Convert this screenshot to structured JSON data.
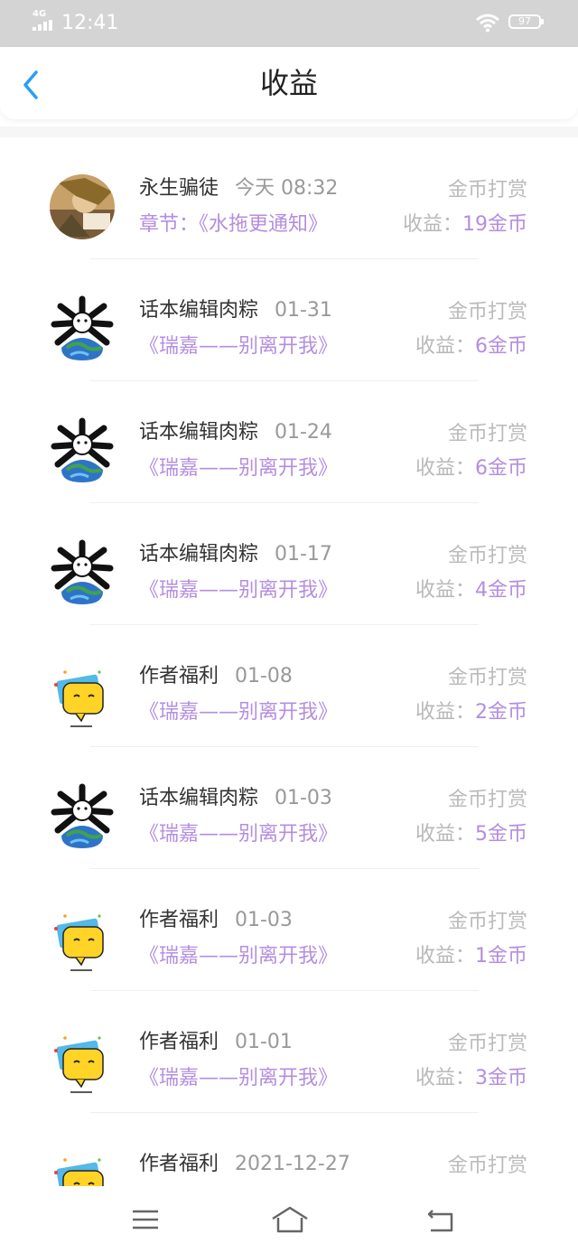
{
  "status_bar": {
    "network": "4G",
    "time": "12:41",
    "battery": "97"
  },
  "header": {
    "title": "收益"
  },
  "entries": [
    {
      "avatar": "user-avatar-photo",
      "name": "永生骗徒",
      "date": "今天 08:32",
      "kind": "金币打赏",
      "book": "章节：《水拖更通知》",
      "income_label": "收益：",
      "income_value": "19金币"
    },
    {
      "avatar": "editor-avatar",
      "name": "话本编辑肉粽",
      "date": "01-31",
      "kind": "金币打赏",
      "book": "《瑞嘉——别离开我》",
      "income_label": "收益：",
      "income_value": "6金币"
    },
    {
      "avatar": "editor-avatar",
      "name": "话本编辑肉粽",
      "date": "01-24",
      "kind": "金币打赏",
      "book": "《瑞嘉——别离开我》",
      "income_label": "收益：",
      "income_value": "6金币"
    },
    {
      "avatar": "editor-avatar",
      "name": "话本编辑肉粽",
      "date": "01-17",
      "kind": "金币打赏",
      "book": "《瑞嘉——别离开我》",
      "income_label": "收益：",
      "income_value": "4金币"
    },
    {
      "avatar": "author-welfare-avatar",
      "name": "作者福利",
      "date": "01-08",
      "kind": "金币打赏",
      "book": "《瑞嘉——别离开我》",
      "income_label": "收益：",
      "income_value": "2金币"
    },
    {
      "avatar": "editor-avatar",
      "name": "话本编辑肉粽",
      "date": "01-03",
      "kind": "金币打赏",
      "book": "《瑞嘉——别离开我》",
      "income_label": "收益：",
      "income_value": "5金币"
    },
    {
      "avatar": "author-welfare-avatar",
      "name": "作者福利",
      "date": "01-03",
      "kind": "金币打赏",
      "book": "《瑞嘉——别离开我》",
      "income_label": "收益：",
      "income_value": "1金币"
    },
    {
      "avatar": "author-welfare-avatar",
      "name": "作者福利",
      "date": "01-01",
      "kind": "金币打赏",
      "book": "《瑞嘉——别离开我》",
      "income_label": "收益：",
      "income_value": "3金币"
    },
    {
      "avatar": "author-welfare-avatar",
      "name": "作者福利",
      "date": "2021-12-27",
      "kind": "金币打赏",
      "book": "",
      "income_label": "",
      "income_value": ""
    }
  ],
  "nav": {
    "menu": "menu-icon",
    "home": "home-icon",
    "back": "back-nav-icon"
  },
  "colors": {
    "accent": "#b48ee0",
    "back_arrow": "#2a9df4",
    "status_bar": "#d4d4d4"
  }
}
